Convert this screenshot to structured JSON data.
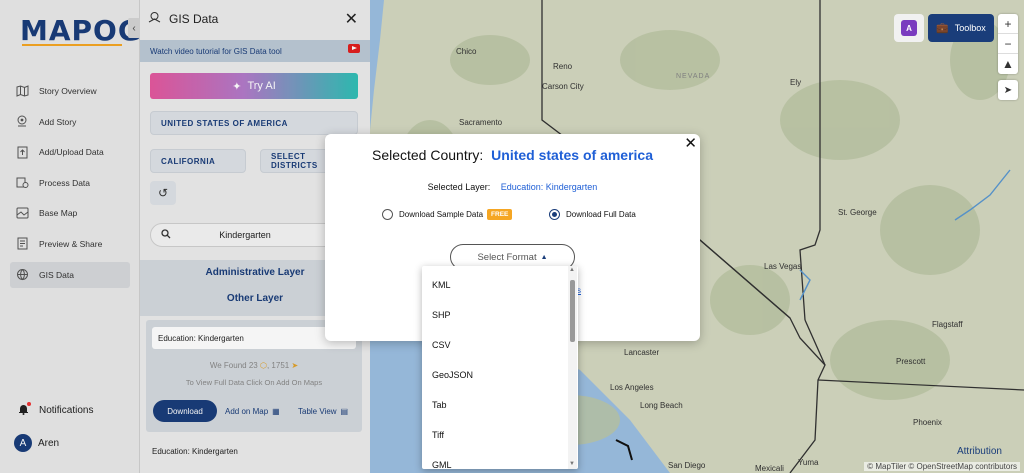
{
  "app": {
    "logo_text": "MAPOG"
  },
  "nav": {
    "items": [
      {
        "label": "Story Overview",
        "icon": "map-icon"
      },
      {
        "label": "Add Story",
        "icon": "pin-icon"
      },
      {
        "label": "Add/Upload Data",
        "icon": "upload-icon"
      },
      {
        "label": "Process Data",
        "icon": "process-icon"
      },
      {
        "label": "Base Map",
        "icon": "layers-icon"
      },
      {
        "label": "Preview & Share",
        "icon": "share-icon"
      },
      {
        "label": "GIS Data",
        "icon": "database-icon",
        "active": true
      }
    ],
    "notifications_label": "Notifications",
    "user": {
      "initial": "A",
      "name": "Aren"
    }
  },
  "panel": {
    "title": "GIS Data",
    "tutorial_text": "Watch video tutorial for GIS Data tool",
    "try_ai_label": "Try AI",
    "country_pill": "UNITED STATES OF AMERICA",
    "state_pill": "CALIFORNIA",
    "districts_pill_line1": "SELECT",
    "districts_pill_line2": "DISTRICTS",
    "search_value": "Kindergarten",
    "admin_layer_title": "Administrative Layer",
    "other_layer_title": "Other Layer",
    "card": {
      "title": "Education: Kindergarten",
      "found_prefix": "We Found",
      "found_count_a": "23",
      "found_count_b": "1751",
      "hint": "To View Full Data Click On Add On Maps",
      "download_label": "Download",
      "add_on_map_label": "Add on Map",
      "table_view_label": "Table View"
    },
    "footer_item": "Education: Kindergarten"
  },
  "map": {
    "cities": [
      {
        "name": "Chico"
      },
      {
        "name": "Reno"
      },
      {
        "name": "Carson City"
      },
      {
        "name": "Sacramento"
      },
      {
        "name": "Ely"
      },
      {
        "name": "St. George"
      },
      {
        "name": "Las Vegas"
      },
      {
        "name": "Flagstaff"
      },
      {
        "name": "Lancaster"
      },
      {
        "name": "Los Angeles"
      },
      {
        "name": "Long Beach"
      },
      {
        "name": "Prescott"
      },
      {
        "name": "Phoenix"
      },
      {
        "name": "San Diego"
      },
      {
        "name": "Mexicali"
      },
      {
        "name": "Yuma"
      }
    ],
    "region_label": "NEVADA",
    "attribution_link": "Attribution",
    "attribution_text": "© MapTiler © OpenStreetMap contributors",
    "toolbox_label": "Toolbox",
    "zoom_in": "+",
    "zoom_out": "−"
  },
  "modal": {
    "title_prefix": "Selected Country:",
    "country": "United states of america",
    "layer_label": "Selected Layer:",
    "layer_value": "Education: Kindergarten",
    "option_sample": "Download Sample Data",
    "free_badge": "FREE",
    "option_full": "Download Full Data",
    "selected_option": "full",
    "format_button": "Select Format",
    "partial_link": "s"
  },
  "dropdown": {
    "options": [
      "KML",
      "SHP",
      "CSV",
      "GeoJSON",
      "Tab",
      "Tiff",
      "GML"
    ]
  },
  "colors": {
    "brand": "#1a3d7a",
    "accent": "#f5a623",
    "link": "#1f5fd6",
    "map_land": "#d8dcc4",
    "map_water": "#9fc3e6"
  }
}
